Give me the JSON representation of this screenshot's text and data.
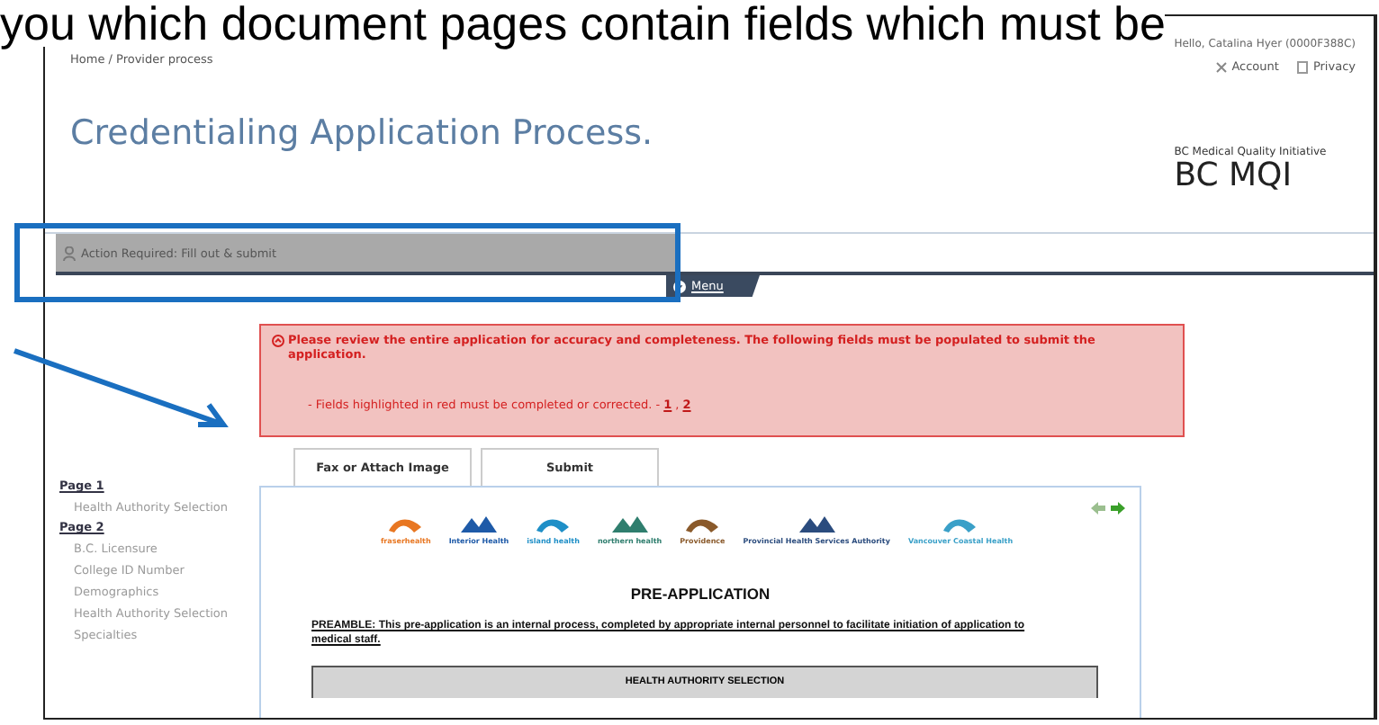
{
  "caption": "you which document pages contain fields which must be",
  "header": {
    "breadcrumb": "Home / Provider process",
    "greeting": "Hello, Catalina Hyer (0000F388C)",
    "links": [
      {
        "label": "Account",
        "kind": "account"
      },
      {
        "label": "Privacy",
        "kind": "privacy"
      }
    ],
    "title": "Credentialing Application Process.",
    "org_name": "BC Medical Quality Initiative",
    "org_short": "BC MQI"
  },
  "action_bar": {
    "text": "Action Required: Fill out & submit",
    "menu": "Menu"
  },
  "alert": {
    "message": "Please review the entire application for accuracy and completeness. The following fields must be populated to submit the application.",
    "detail": "- Fields highlighted in red must be completed or corrected. -",
    "links": [
      "1",
      "2"
    ],
    "link_separator": ","
  },
  "buttons": [
    "Fax or Attach Image",
    "Submit"
  ],
  "sidebar": {
    "items": [
      {
        "label": "Page 1",
        "children": [
          {
            "label": "Health Authority Selection"
          }
        ]
      },
      {
        "label": "Page 2",
        "children": [
          {
            "label": "B.C. Licensure"
          },
          {
            "label": "College ID Number"
          },
          {
            "label": "Demographics"
          },
          {
            "label": "Health Authority Selection"
          },
          {
            "label": "Specialties"
          }
        ]
      }
    ]
  },
  "document": {
    "logos": [
      {
        "text": "fraserhealth",
        "color": "#e87722"
      },
      {
        "text": "Interior Health",
        "color": "#1e5aa8"
      },
      {
        "text": "island health",
        "color": "#1f8fc7"
      },
      {
        "text": "northern health",
        "color": "#2f7e6e"
      },
      {
        "text": "Providence",
        "color": "#8a5a2b"
      },
      {
        "text": "Provincial Health Services Authority",
        "color": "#2b4c7e"
      },
      {
        "text": "Vancouver Coastal Health",
        "color": "#3aa0c8"
      }
    ],
    "heading": "PRE-APPLICATION",
    "preamble": "PREAMBLE: This pre-application is an internal process, completed by appropriate internal personnel to facilitate initiation of application to medical staff.",
    "table_header": "HEALTH AUTHORITY SELECTION"
  }
}
